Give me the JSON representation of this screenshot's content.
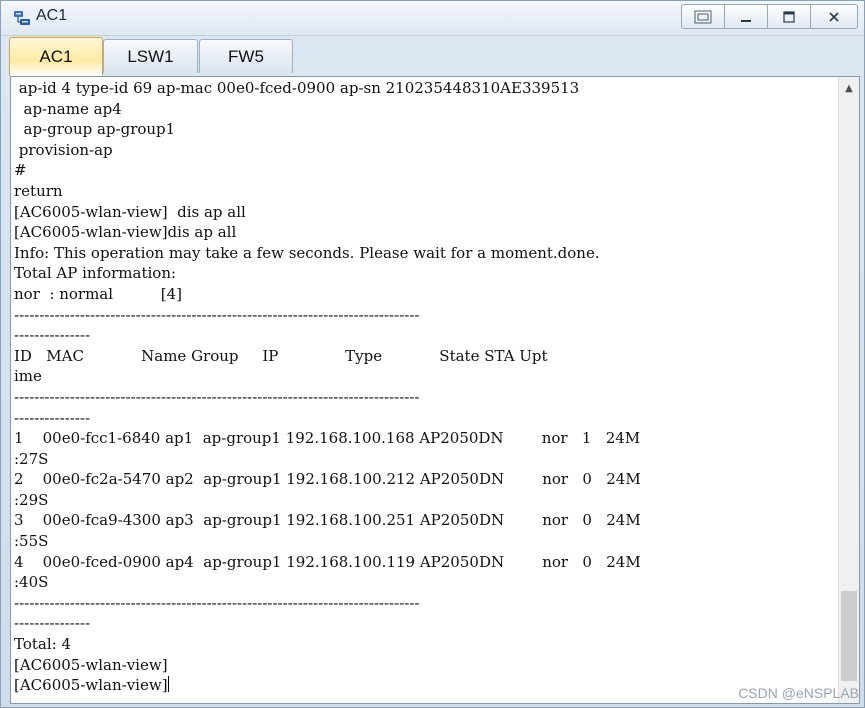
{
  "window": {
    "title": "AC1",
    "controls": [
      "restore-layout",
      "minimize",
      "maximize",
      "close"
    ]
  },
  "tabs": [
    {
      "label": "AC1",
      "active": true
    },
    {
      "label": "LSW1",
      "active": false
    },
    {
      "label": "FW5",
      "active": false
    }
  ],
  "terminal": {
    "lines": [
      " ap-id 4 type-id 69 ap-mac 00e0-fced-0900 ap-sn 210235448310AE339513",
      "  ap-name ap4",
      "  ap-group ap-group1",
      " provision-ap",
      "#",
      "return",
      "[AC6005-wlan-view]  dis ap all",
      "[AC6005-wlan-view]dis ap all",
      "Info: This operation may take a few seconds. Please wait for a moment.done.",
      "Total AP information:",
      "nor  : normal          [4]",
      "--------------------------------------------------------------------------------",
      "---------------",
      "ID   MAC            Name Group     IP              Type            State STA Upt",
      "ime",
      "--------------------------------------------------------------------------------",
      "---------------",
      "1    00e0-fcc1-6840 ap1  ap-group1 192.168.100.168 AP2050DN        nor   1   24M",
      ":27S",
      "2    00e0-fc2a-5470 ap2  ap-group1 192.168.100.212 AP2050DN        nor   0   24M",
      ":29S",
      "3    00e0-fca9-4300 ap3  ap-group1 192.168.100.251 AP2050DN        nor   0   24M",
      ":55S",
      "4    00e0-fced-0900 ap4  ap-group1 192.168.100.119 AP2050DN        nor   0   24M",
      ":40S",
      "--------------------------------------------------------------------------------",
      "---------------",
      "Total: 4",
      "[AC6005-wlan-view]",
      "[AC6005-wlan-view]"
    ]
  },
  "watermark": "CSDN @eNSPLAB"
}
